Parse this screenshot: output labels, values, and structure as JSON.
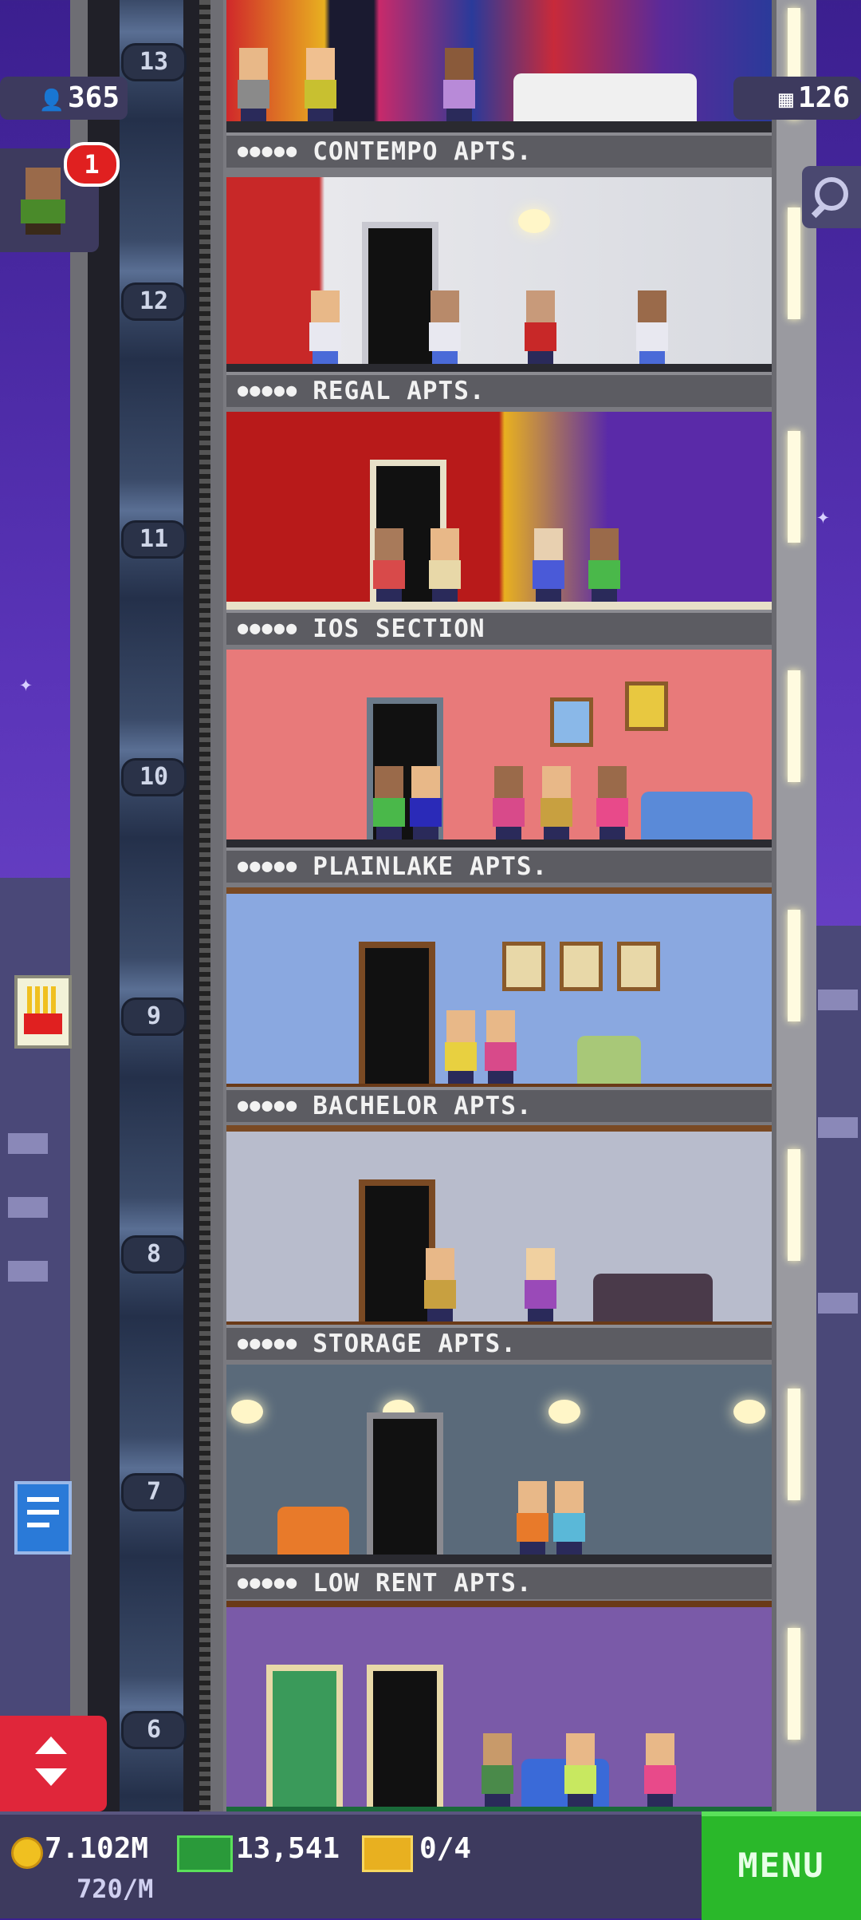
{
  "hud": {
    "population": "365",
    "population_icon": "person-icon",
    "floors_count": "126",
    "floors_icon": "building-icon",
    "notifications": "1",
    "search_icon": "magnifier-icon"
  },
  "floors": [
    {
      "number": "13",
      "name": "CONTEMPO APTS."
    },
    {
      "number": "12",
      "name": "REGAL APTS."
    },
    {
      "number": "11",
      "name": "IOS SECTION"
    },
    {
      "number": "10",
      "name": "PLAINLAKE APTS."
    },
    {
      "number": "9",
      "name": "BACHELOR APTS."
    },
    {
      "number": "8",
      "name": "STORAGE APTS."
    },
    {
      "number": "7",
      "name": "LOW RENT APTS."
    },
    {
      "number": "6",
      "name": ""
    }
  ],
  "sign_stars": "●●●●●",
  "bottom_bar": {
    "coins": "7.102M",
    "coin_icon": "coin-icon",
    "income_rate": "720/M",
    "bux": "13,541",
    "bux_icon": "bux-icon",
    "tickets": "0/4",
    "ticket_icon": "ticket-icon",
    "menu_label": "MENU"
  },
  "colors": {
    "sky_top": "#3b1f8f",
    "menu_green": "#2ab82a",
    "elevator_red": "#e0263a",
    "hud_panel": "#3d3a5e"
  }
}
